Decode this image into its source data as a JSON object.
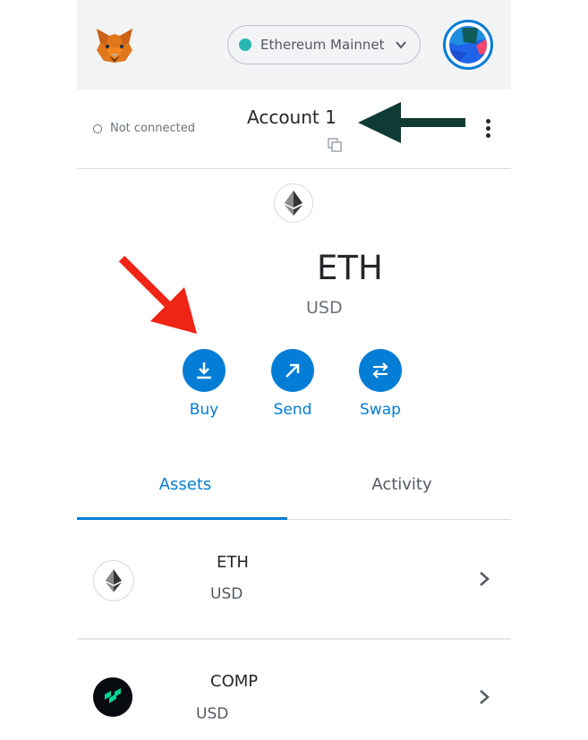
{
  "header": {
    "network_label": "Ethereum Mainnet",
    "logo": "metamask-fox-icon",
    "avatar": "account-jazzicon"
  },
  "account": {
    "connection_status": "Not connected",
    "name": "Account 1"
  },
  "balance": {
    "token": "ETH",
    "fiat": "USD"
  },
  "actions": [
    {
      "label": "Buy",
      "icon": "download-icon"
    },
    {
      "label": "Send",
      "icon": "arrow-up-right-icon"
    },
    {
      "label": "Swap",
      "icon": "swap-icon"
    }
  ],
  "tabs": [
    {
      "label": "Assets",
      "active": true
    },
    {
      "label": "Activity",
      "active": false
    }
  ],
  "assets": [
    {
      "symbol": "ETH",
      "fiat": "USD",
      "icon": "eth-icon"
    },
    {
      "symbol": "COMP",
      "fiat": "USD",
      "icon": "compound-icon"
    }
  ],
  "colors": {
    "accent": "#037dd6",
    "annotation_arrow_dark": "#0e3b33",
    "annotation_arrow_red": "#ee2414",
    "network_dot": "#29b6af"
  }
}
